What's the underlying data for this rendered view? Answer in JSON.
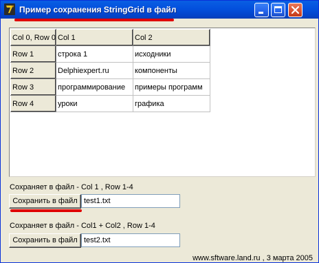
{
  "window": {
    "title": "Пример сохранения StringGrid в файл"
  },
  "grid": {
    "rows": [
      [
        "Col 0, Row 0",
        "Col 1",
        "Col 2"
      ],
      [
        "Row 1",
        "строка 1",
        "исходники"
      ],
      [
        "Row 2",
        "Delphiexpert.ru",
        "компоненты"
      ],
      [
        "Row 3",
        "программирование",
        "примеры программ"
      ],
      [
        "Row 4",
        "уроки",
        "графика"
      ]
    ]
  },
  "section1": {
    "description": "Сохраняет в файл - Col 1 , Row 1-4",
    "button_label": "Сохранить в файл",
    "filename": "test1.txt"
  },
  "section2": {
    "description": "Сохраняет в файл - Col1 + Col2 , Row 1-4",
    "button_label": "Сохранить в файл",
    "filename": "test2.txt"
  },
  "footer": {
    "text": "www.sftware.land.ru , 3 марта 2005"
  },
  "colors": {
    "titlebar": "#0350dd",
    "highlight": "#e00000"
  }
}
